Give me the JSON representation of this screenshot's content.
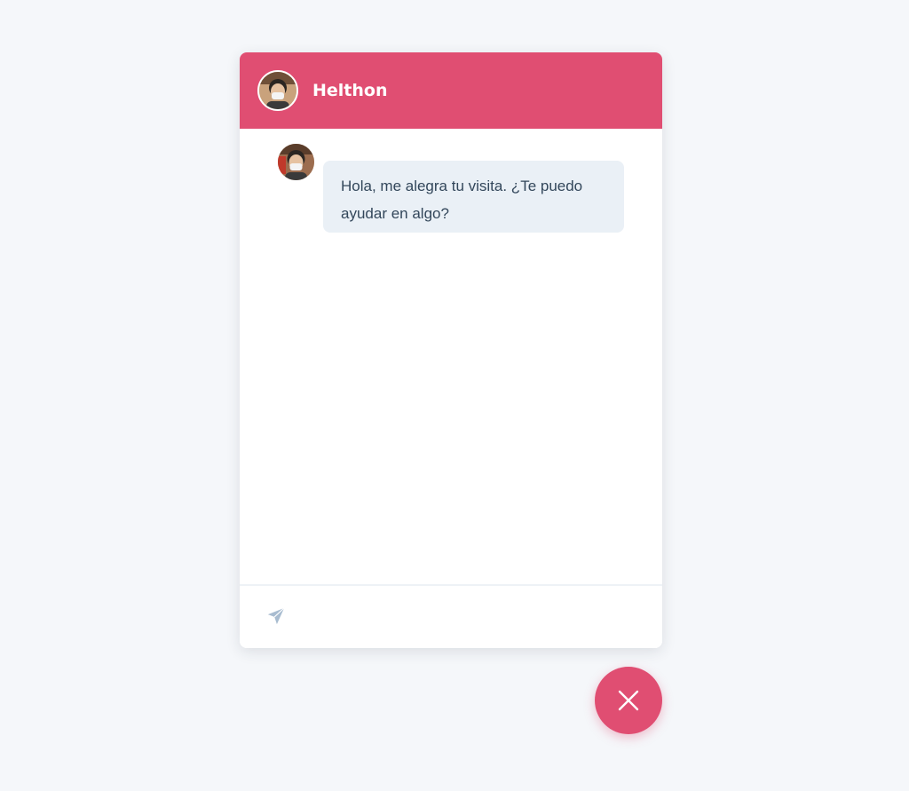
{
  "header": {
    "title": "Helthon",
    "avatar_icon": "bot-avatar"
  },
  "messages": [
    {
      "sender": "bot",
      "avatar_icon": "bot-avatar",
      "text": "Hola, me alegra tu visita. ¿Te puedo ayudar en algo?"
    }
  ],
  "composer": {
    "send_icon": "paper-plane-icon",
    "placeholder": ""
  },
  "launcher": {
    "icon": "close-icon"
  },
  "colors": {
    "accent": "#e04e72",
    "bubble": "#eaf0f6",
    "text": "#33475b",
    "background": "#f5f7fa",
    "send_icon": "#a8bcd0"
  }
}
